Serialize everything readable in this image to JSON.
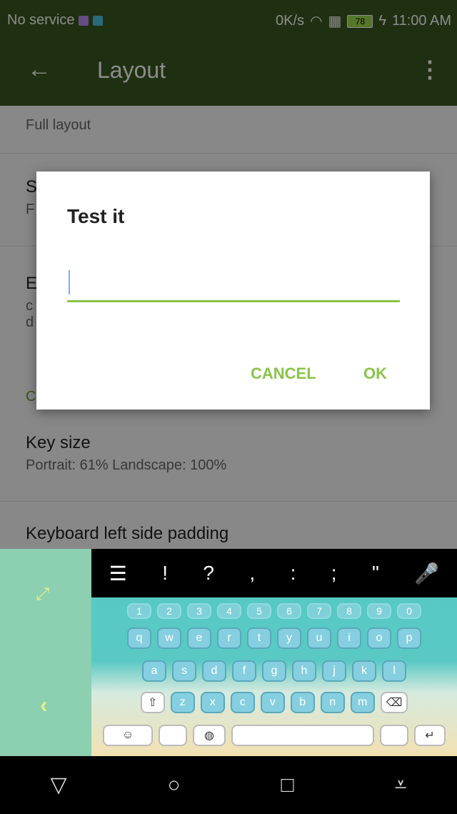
{
  "status": {
    "carrier": "No service",
    "speed": "0K/s",
    "battery": "78",
    "time": "11:00 AM"
  },
  "toolbar": {
    "title": "Layout"
  },
  "settings": [
    {
      "title": "",
      "subtitle": "Full layout"
    },
    {
      "title": "S",
      "subtitle": "F"
    },
    {
      "title": "E",
      "subtitle": "c\nd"
    },
    {
      "title": "C",
      "subtitle": ""
    },
    {
      "title": "Key size",
      "subtitle": "Portrait: 61% Landscape: 100%"
    },
    {
      "title": "Keyboard left side padding",
      "subtitle": ""
    }
  ],
  "dialog": {
    "title": "Test it",
    "input_value": "",
    "cancel_label": "CANCEL",
    "ok_label": "OK"
  },
  "keyboard": {
    "top_symbols": [
      "!",
      "?",
      ",",
      ":",
      ";",
      "\""
    ],
    "number_row": [
      "1",
      "2",
      "3",
      "4",
      "5",
      "6",
      "7",
      "8",
      "9",
      "0"
    ],
    "row1": [
      "q",
      "w",
      "e",
      "r",
      "t",
      "y",
      "u",
      "i",
      "o",
      "p"
    ],
    "row2": [
      "a",
      "s",
      "d",
      "f",
      "g",
      "h",
      "j",
      "k",
      "l"
    ],
    "row3": [
      "z",
      "x",
      "c",
      "v",
      "b",
      "n",
      "m"
    ],
    "accent": "#8bc34a"
  },
  "nav": {
    "back_icon": "back-triangle-icon",
    "home_icon": "home-circle-icon",
    "recents_icon": "recents-square-icon",
    "menu_icon": "menu-down-icon"
  }
}
